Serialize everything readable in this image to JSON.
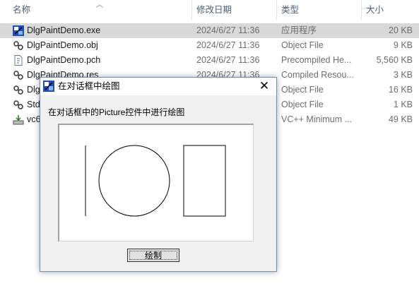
{
  "columns": {
    "name": "名称",
    "date": "修改日期",
    "type": "类型",
    "size": "大小"
  },
  "files": [
    {
      "name": "DlgPaintDemo.exe",
      "date": "2024/6/27 11:36",
      "type": "应用程序",
      "size": "20 KB",
      "icon": "exe-app-icon"
    },
    {
      "name": "DlgPaintDemo.obj",
      "date": "2024/6/27 11:36",
      "type": "Object File",
      "size": "9 KB",
      "icon": "obj-file-icon"
    },
    {
      "name": "DlgPaintDemo.pch",
      "date": "2024/6/27 11:36",
      "type": "Precompiled He...",
      "size": "5,560 KB",
      "icon": "pch-file-icon"
    },
    {
      "name": "DlgPaintDemo.res",
      "date": "2024/6/27 11:36",
      "type": "Compiled Resou...",
      "size": "3 KB",
      "icon": "res-file-icon"
    },
    {
      "name": "Dlg",
      "date": "",
      "type": "Object File",
      "size": "16 KB",
      "icon": "obj-file-icon"
    },
    {
      "name": "Std",
      "date": "",
      "type": "Object File",
      "size": "1 KB",
      "icon": "obj-file-icon"
    },
    {
      "name": "vc6",
      "date": "",
      "type": "VC++ Minimum ...",
      "size": "49 KB",
      "icon": "idb-file-icon"
    }
  ],
  "dialog": {
    "title": "在对话框中绘图",
    "close_glyph": "✕",
    "label": "在对话框中的Picture控件中进行绘图",
    "button_label": "绘制",
    "icon": "app-icon"
  },
  "colors": {
    "selected_row": "#cce8ff",
    "header_text": "#4c607a",
    "dialog_bg": "#f0f0f0"
  }
}
